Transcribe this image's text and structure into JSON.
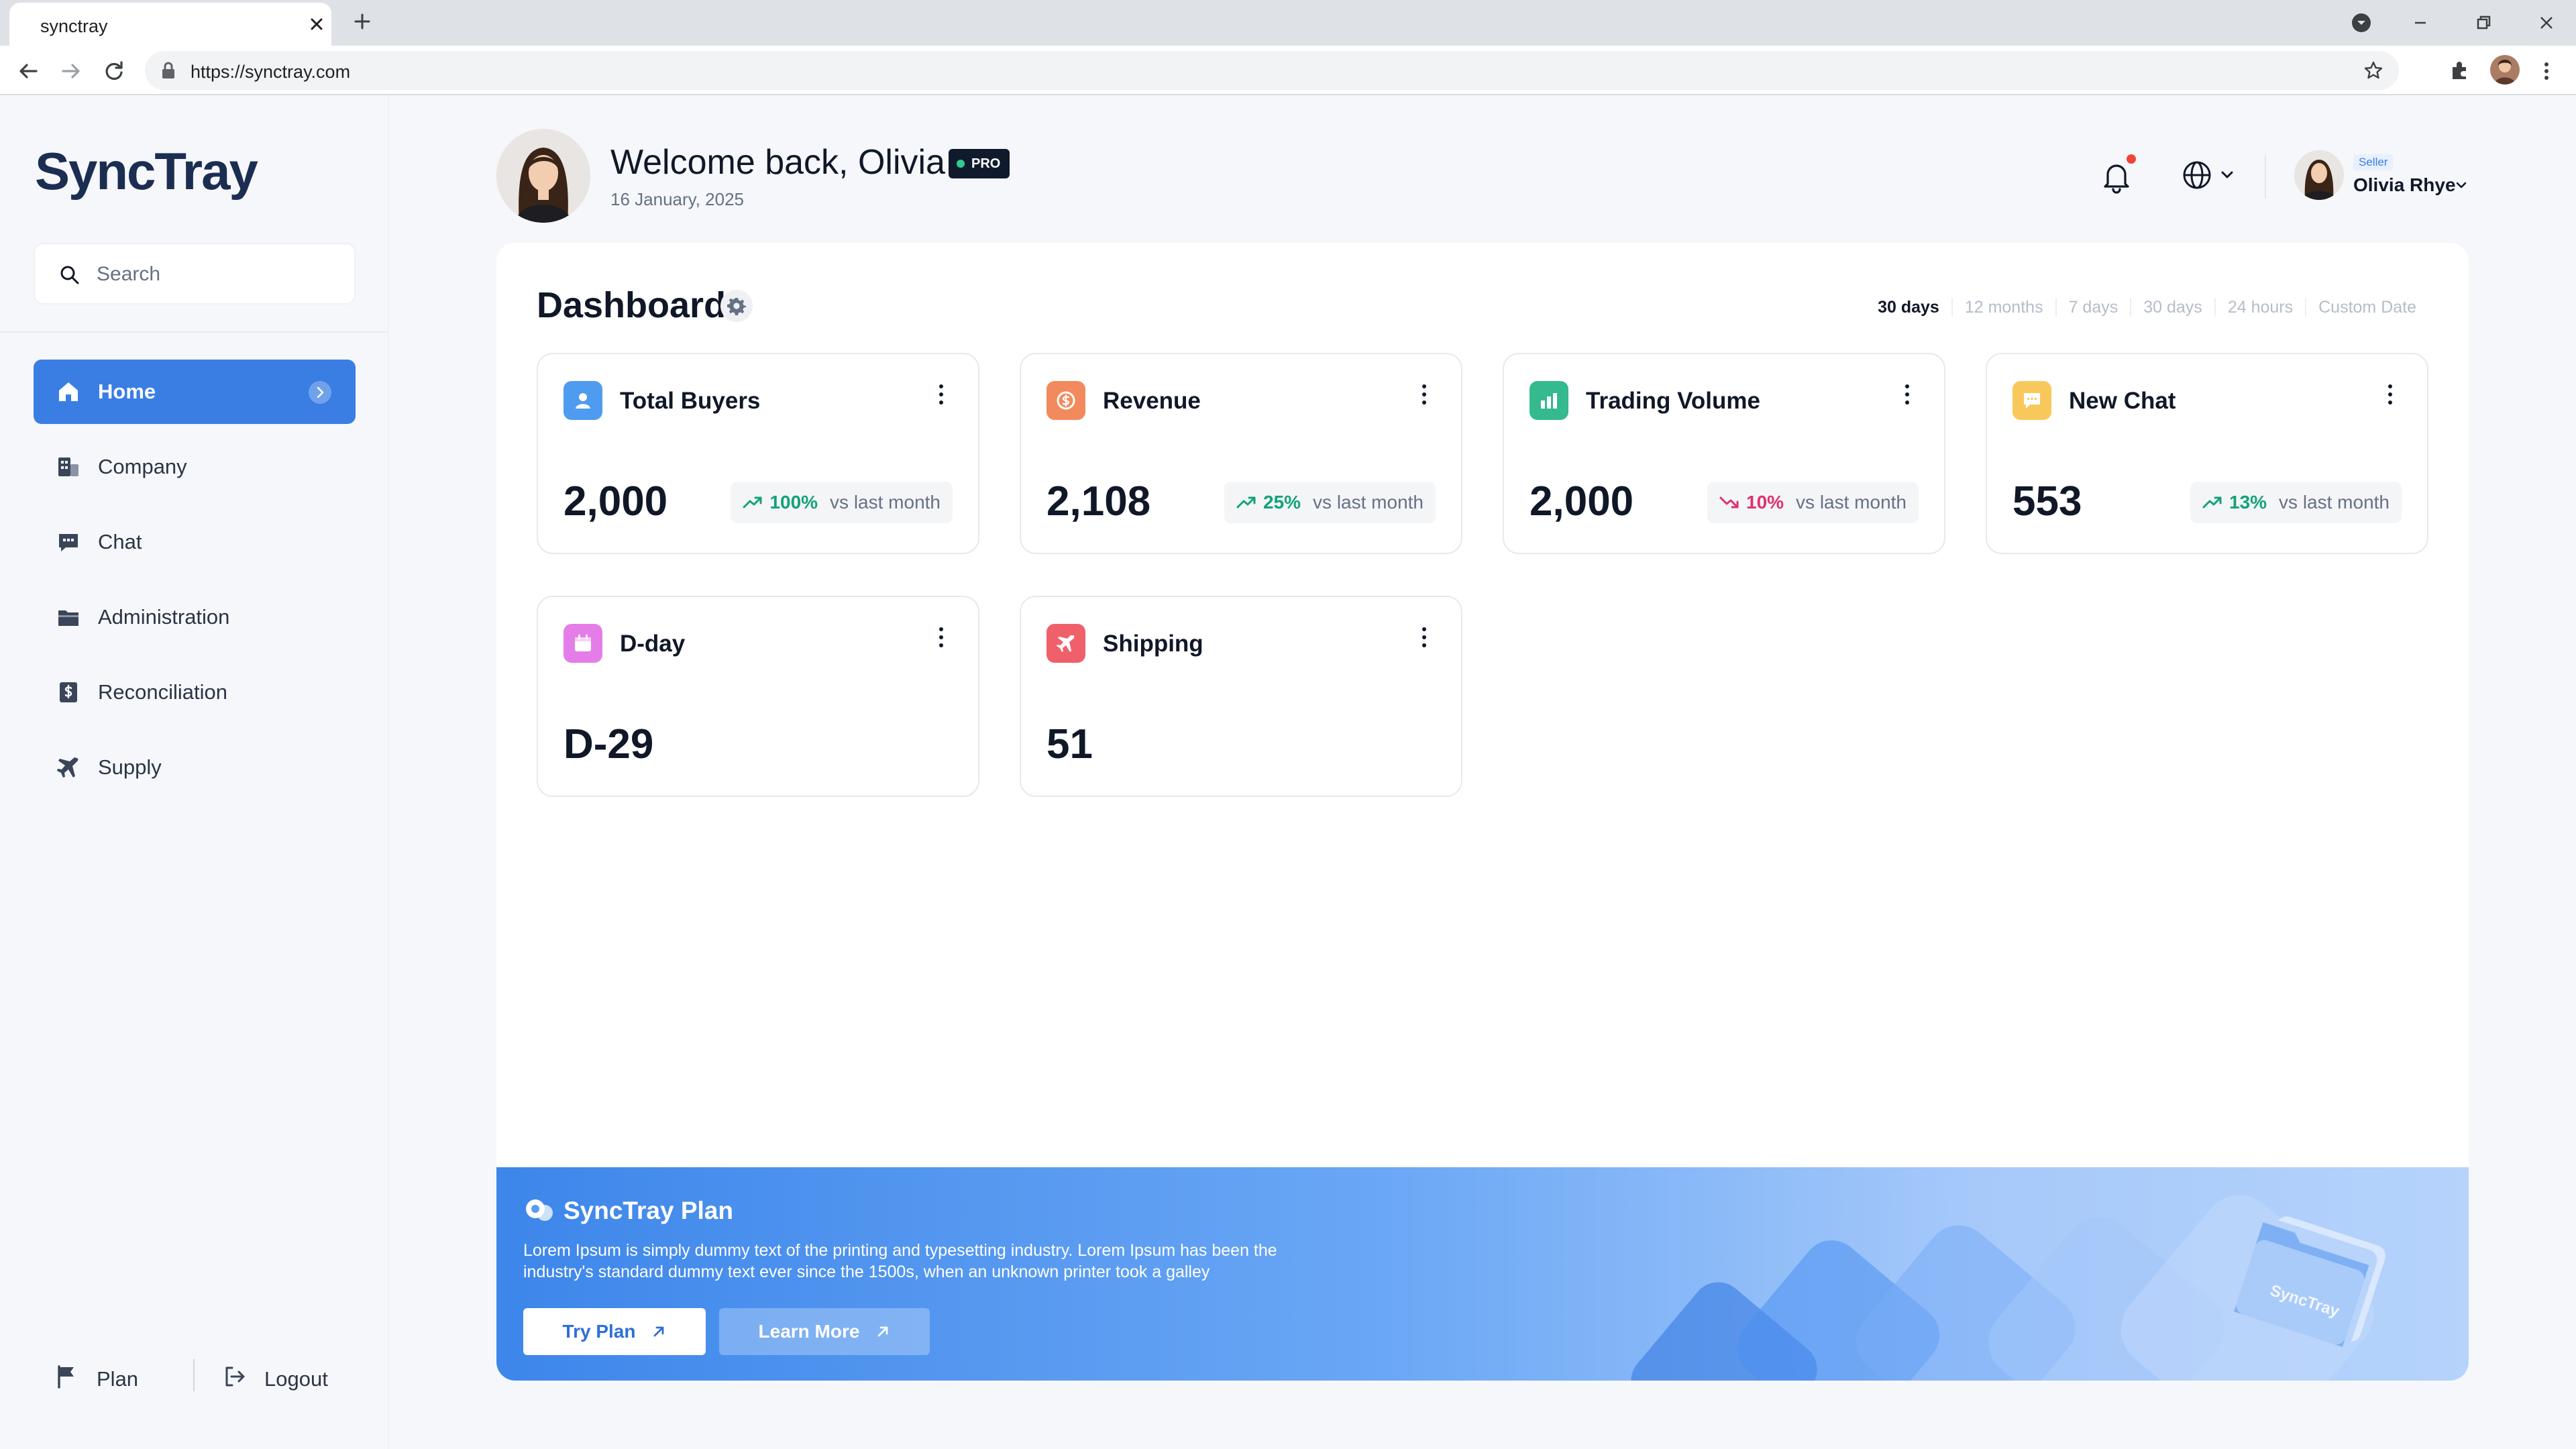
{
  "browser": {
    "tab_title": "synctray",
    "url": "https://synctray.com"
  },
  "sidebar": {
    "logo": "SyncTray",
    "search_placeholder": "Search",
    "items": [
      {
        "label": "Home",
        "icon": "home-icon",
        "active": true
      },
      {
        "label": "Company",
        "icon": "building-icon",
        "active": false
      },
      {
        "label": "Chat",
        "icon": "chat-icon",
        "active": false
      },
      {
        "label": "Administration",
        "icon": "folder-icon",
        "active": false
      },
      {
        "label": "Reconciliation",
        "icon": "dollar-doc-icon",
        "active": false
      },
      {
        "label": "Supply",
        "icon": "plane-icon",
        "active": false
      }
    ],
    "bottom": {
      "plan_label": "Plan",
      "logout_label": "Logout"
    }
  },
  "header": {
    "welcome": "Welcome back, Olivia",
    "badge": "PRO",
    "date": "16 January, 2025",
    "user_role": "Seller",
    "user_name": "Olivia Rhye"
  },
  "dashboard": {
    "title": "Dashboard",
    "ranges": [
      "30 days",
      "12 months",
      "7 days",
      "30 days",
      "24 hours",
      "Custom Date"
    ],
    "active_range_index": 0,
    "cards": [
      {
        "title": "Total Buyers",
        "value": "2,000",
        "trend_pct": "100%",
        "trend_dir": "up",
        "trend_label": "vs last month",
        "icon": "user-icon",
        "icon_bg": "#4e9bf0"
      },
      {
        "title": "Revenue",
        "value": "2,108",
        "trend_pct": "25%",
        "trend_dir": "up",
        "trend_label": "vs last month",
        "icon": "money-icon",
        "icon_bg": "#f28a5e"
      },
      {
        "title": "Trading Volume",
        "value": "2,000",
        "trend_pct": "10%",
        "trend_dir": "down",
        "trend_label": "vs last month",
        "icon": "bar-chart-icon",
        "icon_bg": "#35b98f"
      },
      {
        "title": "New Chat",
        "value": "553",
        "trend_pct": "13%",
        "trend_dir": "up",
        "trend_label": "vs last month",
        "icon": "chat-bubble-icon",
        "icon_bg": "#f8c95a"
      },
      {
        "title": "D-day",
        "value": "D-29",
        "icon": "calendar-icon",
        "icon_bg": "#e57de8"
      },
      {
        "title": "Shipping",
        "value": "51",
        "icon": "plane-icon",
        "icon_bg": "#f0606a"
      }
    ]
  },
  "plan_banner": {
    "title": "SyncTray Plan",
    "text": "Lorem Ipsum is simply dummy text of the printing and typesetting industry. Lorem Ipsum has been the industry's standard dummy text ever since the 1500s, when an unknown printer took a galley",
    "try_label": "Try Plan",
    "learn_label": "Learn More",
    "illustration_text": "SyncTray"
  },
  "colors": {
    "accent": "#3a7ee4",
    "trend_up": "#12a27a",
    "trend_down": "#e0306f"
  }
}
